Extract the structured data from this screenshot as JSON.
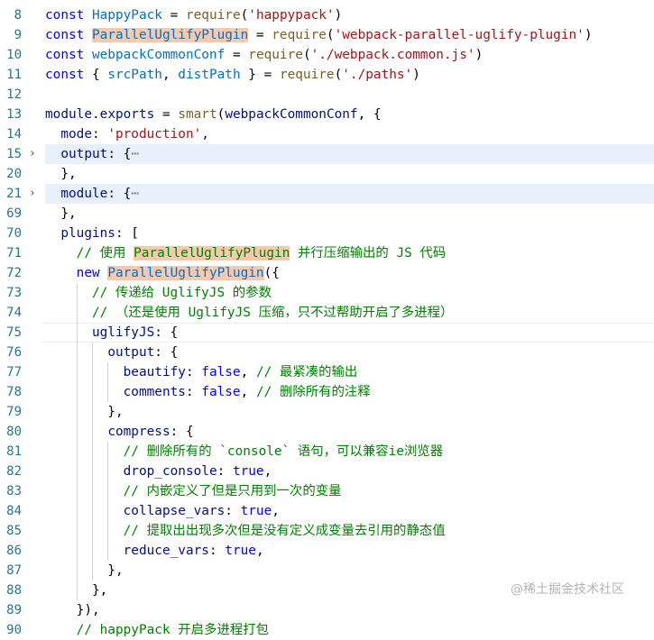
{
  "colors": {
    "keyword": "#0000ff",
    "identifier": "#0070c1",
    "function": "#795e26",
    "string": "#a31515",
    "comment": "#008000",
    "property": "#001080",
    "highlight": "#f7c9ae",
    "folded_bg": "#e8f0fb"
  },
  "watermark": "@稀土掘金技术社区",
  "lines": [
    {
      "n": "8",
      "t": [
        [
          "kw",
          "const "
        ],
        [
          "id",
          "HappyPack"
        ],
        [
          "pn",
          " = "
        ],
        [
          "fn",
          "require"
        ],
        [
          "pn",
          "("
        ],
        [
          "str",
          "'happypack'"
        ],
        [
          "pn",
          ")"
        ]
      ]
    },
    {
      "n": "9",
      "t": [
        [
          "kw",
          "const "
        ],
        [
          "id hl",
          "ParallelUglifyPlugin"
        ],
        [
          "pn",
          " = "
        ],
        [
          "fn",
          "require"
        ],
        [
          "pn",
          "("
        ],
        [
          "str",
          "'webpack-parallel-uglify-plugin'"
        ],
        [
          "pn",
          ")"
        ]
      ]
    },
    {
      "n": "10",
      "t": [
        [
          "kw",
          "const "
        ],
        [
          "id",
          "webpackCommonConf"
        ],
        [
          "pn",
          " = "
        ],
        [
          "fn",
          "require"
        ],
        [
          "pn",
          "("
        ],
        [
          "str",
          "'./webpack.common.js'"
        ],
        [
          "pn",
          ")"
        ]
      ]
    },
    {
      "n": "11",
      "t": [
        [
          "kw",
          "const "
        ],
        [
          "pn",
          "{ "
        ],
        [
          "id",
          "srcPath"
        ],
        [
          "pn",
          ", "
        ],
        [
          "id",
          "distPath"
        ],
        [
          "pn",
          " } = "
        ],
        [
          "fn",
          "require"
        ],
        [
          "pn",
          "("
        ],
        [
          "str",
          "'./paths'"
        ],
        [
          "pn",
          ")"
        ]
      ]
    },
    {
      "n": "12",
      "t": []
    },
    {
      "n": "13",
      "t": [
        [
          "pr",
          "module"
        ],
        [
          "pn",
          "."
        ],
        [
          "pr",
          "exports"
        ],
        [
          "pn",
          " = "
        ],
        [
          "fn",
          "smart"
        ],
        [
          "pn",
          "("
        ],
        [
          "pr",
          "webpackCommonConf"
        ],
        [
          "pn",
          ", {"
        ]
      ]
    },
    {
      "n": "14",
      "t": [
        [
          "pn",
          "  "
        ],
        [
          "pr",
          "mode"
        ],
        [
          "pn",
          ": "
        ],
        [
          "str",
          "'production'"
        ],
        [
          "pn",
          ","
        ]
      ]
    },
    {
      "n": "15",
      "fold": true,
      "t": [
        [
          "pn",
          "  "
        ],
        [
          "pr",
          "output"
        ],
        [
          "pn",
          ": {"
        ],
        [
          "el",
          "⋯"
        ]
      ]
    },
    {
      "n": "20",
      "t": [
        [
          "pn",
          "  },"
        ]
      ]
    },
    {
      "n": "21",
      "fold": true,
      "t": [
        [
          "pn",
          "  "
        ],
        [
          "pr",
          "module"
        ],
        [
          "pn",
          ": {"
        ],
        [
          "el",
          "⋯"
        ]
      ]
    },
    {
      "n": "69",
      "t": [
        [
          "pn",
          "  },"
        ]
      ]
    },
    {
      "n": "70",
      "t": [
        [
          "pn",
          "  "
        ],
        [
          "pr",
          "plugins"
        ],
        [
          "pn",
          ": ["
        ]
      ]
    },
    {
      "n": "71",
      "t": [
        [
          "pn",
          "    "
        ],
        [
          "cm",
          "// 使用 "
        ],
        [
          "cm hl",
          "ParallelUglifyPlugin"
        ],
        [
          "cm",
          " 并行压缩输出的 JS 代码"
        ]
      ]
    },
    {
      "n": "72",
      "t": [
        [
          "pn",
          "    "
        ],
        [
          "kw",
          "new "
        ],
        [
          "id hl",
          "ParallelUglifyPlugin"
        ],
        [
          "pn",
          "({"
        ]
      ]
    },
    {
      "n": "73",
      "t": [
        [
          "pn",
          "      "
        ],
        [
          "cm",
          "// 传递给 UglifyJS 的参数"
        ]
      ]
    },
    {
      "n": "74",
      "t": [
        [
          "pn",
          "      "
        ],
        [
          "cm",
          "// （还是使用 UglifyJS 压缩，只不过帮助开启了多进程）"
        ]
      ]
    },
    {
      "n": "75",
      "current": true,
      "t": [
        [
          "pn",
          "      "
        ],
        [
          "pr",
          "uglifyJS"
        ],
        [
          "pn",
          ": {"
        ]
      ]
    },
    {
      "n": "76",
      "t": [
        [
          "pn",
          "        "
        ],
        [
          "pr",
          "output"
        ],
        [
          "pn",
          ": {"
        ]
      ]
    },
    {
      "n": "77",
      "t": [
        [
          "pn",
          "          "
        ],
        [
          "pr",
          "beautify"
        ],
        [
          "pn",
          ": "
        ],
        [
          "kw",
          "false"
        ],
        [
          "pn",
          ", "
        ],
        [
          "cm",
          "// 最紧凑的输出"
        ]
      ]
    },
    {
      "n": "78",
      "t": [
        [
          "pn",
          "          "
        ],
        [
          "pr",
          "comments"
        ],
        [
          "pn",
          ": "
        ],
        [
          "kw",
          "false"
        ],
        [
          "pn",
          ", "
        ],
        [
          "cm",
          "// 删除所有的注释"
        ]
      ]
    },
    {
      "n": "79",
      "t": [
        [
          "pn",
          "        },"
        ]
      ]
    },
    {
      "n": "80",
      "t": [
        [
          "pn",
          "        "
        ],
        [
          "pr",
          "compress"
        ],
        [
          "pn",
          ": {"
        ]
      ]
    },
    {
      "n": "81",
      "t": [
        [
          "pn",
          "          "
        ],
        [
          "cm",
          "// 删除所有的 `console` 语句，可以兼容ie浏览器"
        ]
      ]
    },
    {
      "n": "82",
      "t": [
        [
          "pn",
          "          "
        ],
        [
          "pr",
          "drop_console"
        ],
        [
          "pn",
          ": "
        ],
        [
          "kw",
          "true"
        ],
        [
          "pn",
          ","
        ]
      ]
    },
    {
      "n": "83",
      "t": [
        [
          "pn",
          "          "
        ],
        [
          "cm",
          "// 内嵌定义了但是只用到一次的变量"
        ]
      ]
    },
    {
      "n": "84",
      "t": [
        [
          "pn",
          "          "
        ],
        [
          "pr",
          "collapse_vars"
        ],
        [
          "pn",
          ": "
        ],
        [
          "kw",
          "true"
        ],
        [
          "pn",
          ","
        ]
      ]
    },
    {
      "n": "85",
      "t": [
        [
          "pn",
          "          "
        ],
        [
          "cm",
          "// 提取出出现多次但是没有定义成变量去引用的静态值"
        ]
      ]
    },
    {
      "n": "86",
      "t": [
        [
          "pn",
          "          "
        ],
        [
          "pr",
          "reduce_vars"
        ],
        [
          "pn",
          ": "
        ],
        [
          "kw",
          "true"
        ],
        [
          "pn",
          ","
        ]
      ]
    },
    {
      "n": "87",
      "t": [
        [
          "pn",
          "        },"
        ]
      ]
    },
    {
      "n": "88",
      "t": [
        [
          "pn",
          "      },"
        ]
      ]
    },
    {
      "n": "89",
      "t": [
        [
          "pn",
          "    }),"
        ]
      ]
    },
    {
      "n": "90",
      "t": [
        [
          "pn",
          "    "
        ],
        [
          "cm",
          "// happyPack 开启多进程打包"
        ]
      ]
    }
  ]
}
